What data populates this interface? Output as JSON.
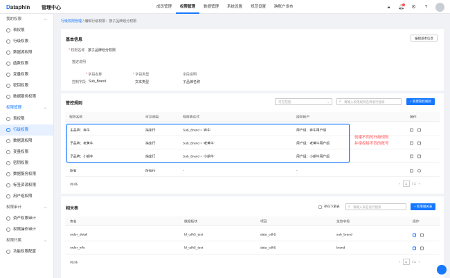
{
  "header": {
    "logo_d": "D",
    "logo_rest": "ataphin",
    "app_title": "管理中心",
    "nav": [
      "成员管理",
      "权限管理",
      "数据管理",
      "系统设置",
      "规范设置",
      "跨账户发布"
    ],
    "nav_active": 1
  },
  "sidebar": {
    "group_mine": "我的权限",
    "mine_items": [
      "表权限",
      "行级权限",
      "数据源权限",
      "函数权限",
      "变量权限",
      "密钥权限",
      "数据服务权限"
    ],
    "group_mgmt": "权限管理",
    "mgmt_items": [
      "表权限",
      "行级权限",
      "数据源权限",
      "变量权限",
      "密钥权限",
      "数据服务权限",
      "标签资源权限",
      "用户组权限"
    ],
    "group_audit": "权限审计",
    "audit_items": [
      "资产权限审计",
      "权限操作审计"
    ],
    "group_owner": "权限归属",
    "owner_items": [
      "功能权限配置"
    ]
  },
  "breadcrumb": {
    "link": "行级权限管理",
    "sep": "/",
    "current": "编辑行级权限：按子品牌划分权限"
  },
  "basic": {
    "title": "基本信息",
    "edit_button": "编辑基本信息",
    "name_label": "权限名称",
    "name_value": "按子品牌划分权限",
    "desc_label": "描述说明",
    "field_name_label": "字段名称",
    "field_type_label": "字段类型",
    "field_desc_label": "字段说明",
    "control_label": "控制字段",
    "control_field": "Sub_Brand",
    "control_type": "文本类型",
    "control_desc": "子品牌名称"
  },
  "rules": {
    "title": "管控规则",
    "scope_placeholder": "可见范围",
    "search_placeholder": "请输入权限规则名称进行搜索",
    "new_button": "+ 新建管控规则",
    "headers": [
      "规则名称",
      "可见范围",
      "规则表达式",
      "授权账户",
      "操作"
    ],
    "rows": [
      {
        "name": "主品牌：奔牛",
        "scope": "指定行",
        "expr": "Sub_Brand = '奔牛'",
        "account": "用户组：奔牛用户组"
      },
      {
        "name": "子品牌：老黄牛",
        "scope": "指定行",
        "expr": "Sub_Brand = '老黄牛'",
        "account": "用户组：老黄牛用户组"
      },
      {
        "name": "子品牌：小蜗牛",
        "scope": "指定行",
        "expr": "Sub_Brand = '小蜗牛'",
        "account": "用户组：小蜗牛用户组"
      },
      {
        "name": "所有",
        "scope": "所有行",
        "expr": "-",
        "account": "-"
      }
    ],
    "total": "共4条",
    "page": "1",
    "pages": "/ 1"
  },
  "annotation": {
    "line1": "创建不同的行级规则",
    "line2": "并授权给不同的账号"
  },
  "related": {
    "title": "相关表",
    "checkbox_label": "存在下游表",
    "search_placeholder": "请输入表名进行搜索",
    "new_button": "+ 新增相关表",
    "headers": [
      "表名",
      "数据板块",
      "项目",
      "生效字段",
      "操作"
    ],
    "rows": [
      {
        "table": "order_detail",
        "block": "ld_cdh5_test",
        "project": "data_cdh5",
        "field": "sub_brand"
      },
      {
        "table": "order_info",
        "block": "ld_cdh5_test",
        "project": "data_cdh5",
        "field": "brand"
      }
    ],
    "total": "共2条",
    "page": "1",
    "pages": "/ 1"
  }
}
